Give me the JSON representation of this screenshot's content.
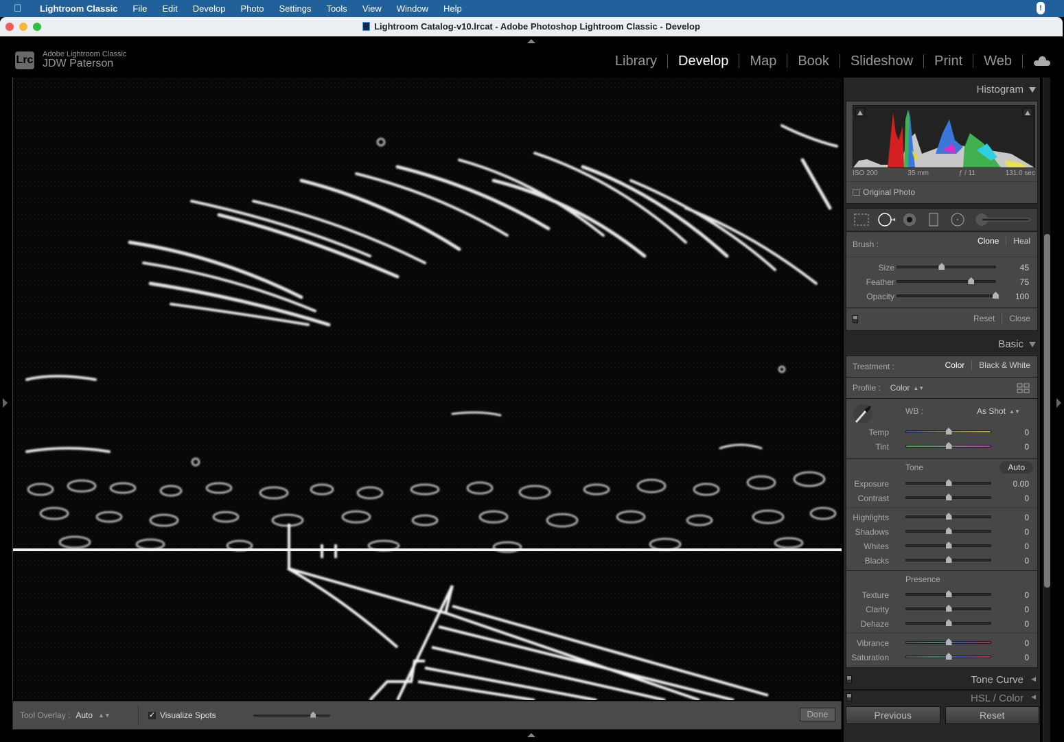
{
  "menubar": {
    "apple": "",
    "items": [
      "Lightroom Classic",
      "File",
      "Edit",
      "Develop",
      "Photo",
      "Settings",
      "Tools",
      "View",
      "Window",
      "Help"
    ]
  },
  "window": {
    "title": "Lightroom Catalog-v10.lrcat - Adobe Photoshop Lightroom Classic - Develop"
  },
  "identity": {
    "logo": "Lrc",
    "product": "Adobe Lightroom Classic",
    "user": "JDW Paterson"
  },
  "modules": [
    "Library",
    "Develop",
    "Map",
    "Book",
    "Slideshow",
    "Print",
    "Web"
  ],
  "active_module": "Develop",
  "histogram": {
    "title": "Histogram",
    "iso": "ISO 200",
    "focal": "35 mm",
    "aperture": "ƒ / 11",
    "shutter": "131.0 sec",
    "original_photo": "Original Photo"
  },
  "spot_removal": {
    "brush_label": "Brush :",
    "clone": "Clone",
    "heal": "Heal",
    "sliders": [
      {
        "label": "Size",
        "value": "45",
        "pos": 0.45
      },
      {
        "label": "Feather",
        "value": "75",
        "pos": 0.75
      },
      {
        "label": "Opacity",
        "value": "100",
        "pos": 1.0
      }
    ],
    "reset": "Reset",
    "close": "Close"
  },
  "basic": {
    "title": "Basic",
    "treatment_label": "Treatment :",
    "treatment_color": "Color",
    "treatment_bw": "Black & White",
    "profile_label": "Profile :",
    "profile_value": "Color",
    "wb_label": "WB :",
    "wb_value": "As Shot",
    "wb_sliders": [
      {
        "label": "Temp",
        "value": "0",
        "pos": 0.5
      },
      {
        "label": "Tint",
        "value": "0",
        "pos": 0.5
      }
    ],
    "tone_label": "Tone",
    "auto": "Auto",
    "tone_sliders_a": [
      {
        "label": "Exposure",
        "value": "0.00",
        "pos": 0.5
      },
      {
        "label": "Contrast",
        "value": "0",
        "pos": 0.5
      }
    ],
    "tone_sliders_b": [
      {
        "label": "Highlights",
        "value": "0",
        "pos": 0.5
      },
      {
        "label": "Shadows",
        "value": "0",
        "pos": 0.5
      },
      {
        "label": "Whites",
        "value": "0",
        "pos": 0.5
      },
      {
        "label": "Blacks",
        "value": "0",
        "pos": 0.5
      }
    ],
    "presence_label": "Presence",
    "presence_sliders_a": [
      {
        "label": "Texture",
        "value": "0",
        "pos": 0.5
      },
      {
        "label": "Clarity",
        "value": "0",
        "pos": 0.5
      },
      {
        "label": "Dehaze",
        "value": "0",
        "pos": 0.5
      }
    ],
    "presence_sliders_b": [
      {
        "label": "Vibrance",
        "value": "0",
        "pos": 0.5
      },
      {
        "label": "Saturation",
        "value": "0",
        "pos": 0.5
      }
    ]
  },
  "collapsed_panels": [
    "Tone Curve",
    "HSL / Color"
  ],
  "bottom_buttons": {
    "previous": "Previous",
    "reset": "Reset"
  },
  "toolbar": {
    "overlay_label": "Tool Overlay :",
    "overlay_value": "Auto",
    "visualize_spots": "Visualize Spots",
    "visualize_checked": true,
    "visualize_threshold": 0.75,
    "done": "Done"
  }
}
